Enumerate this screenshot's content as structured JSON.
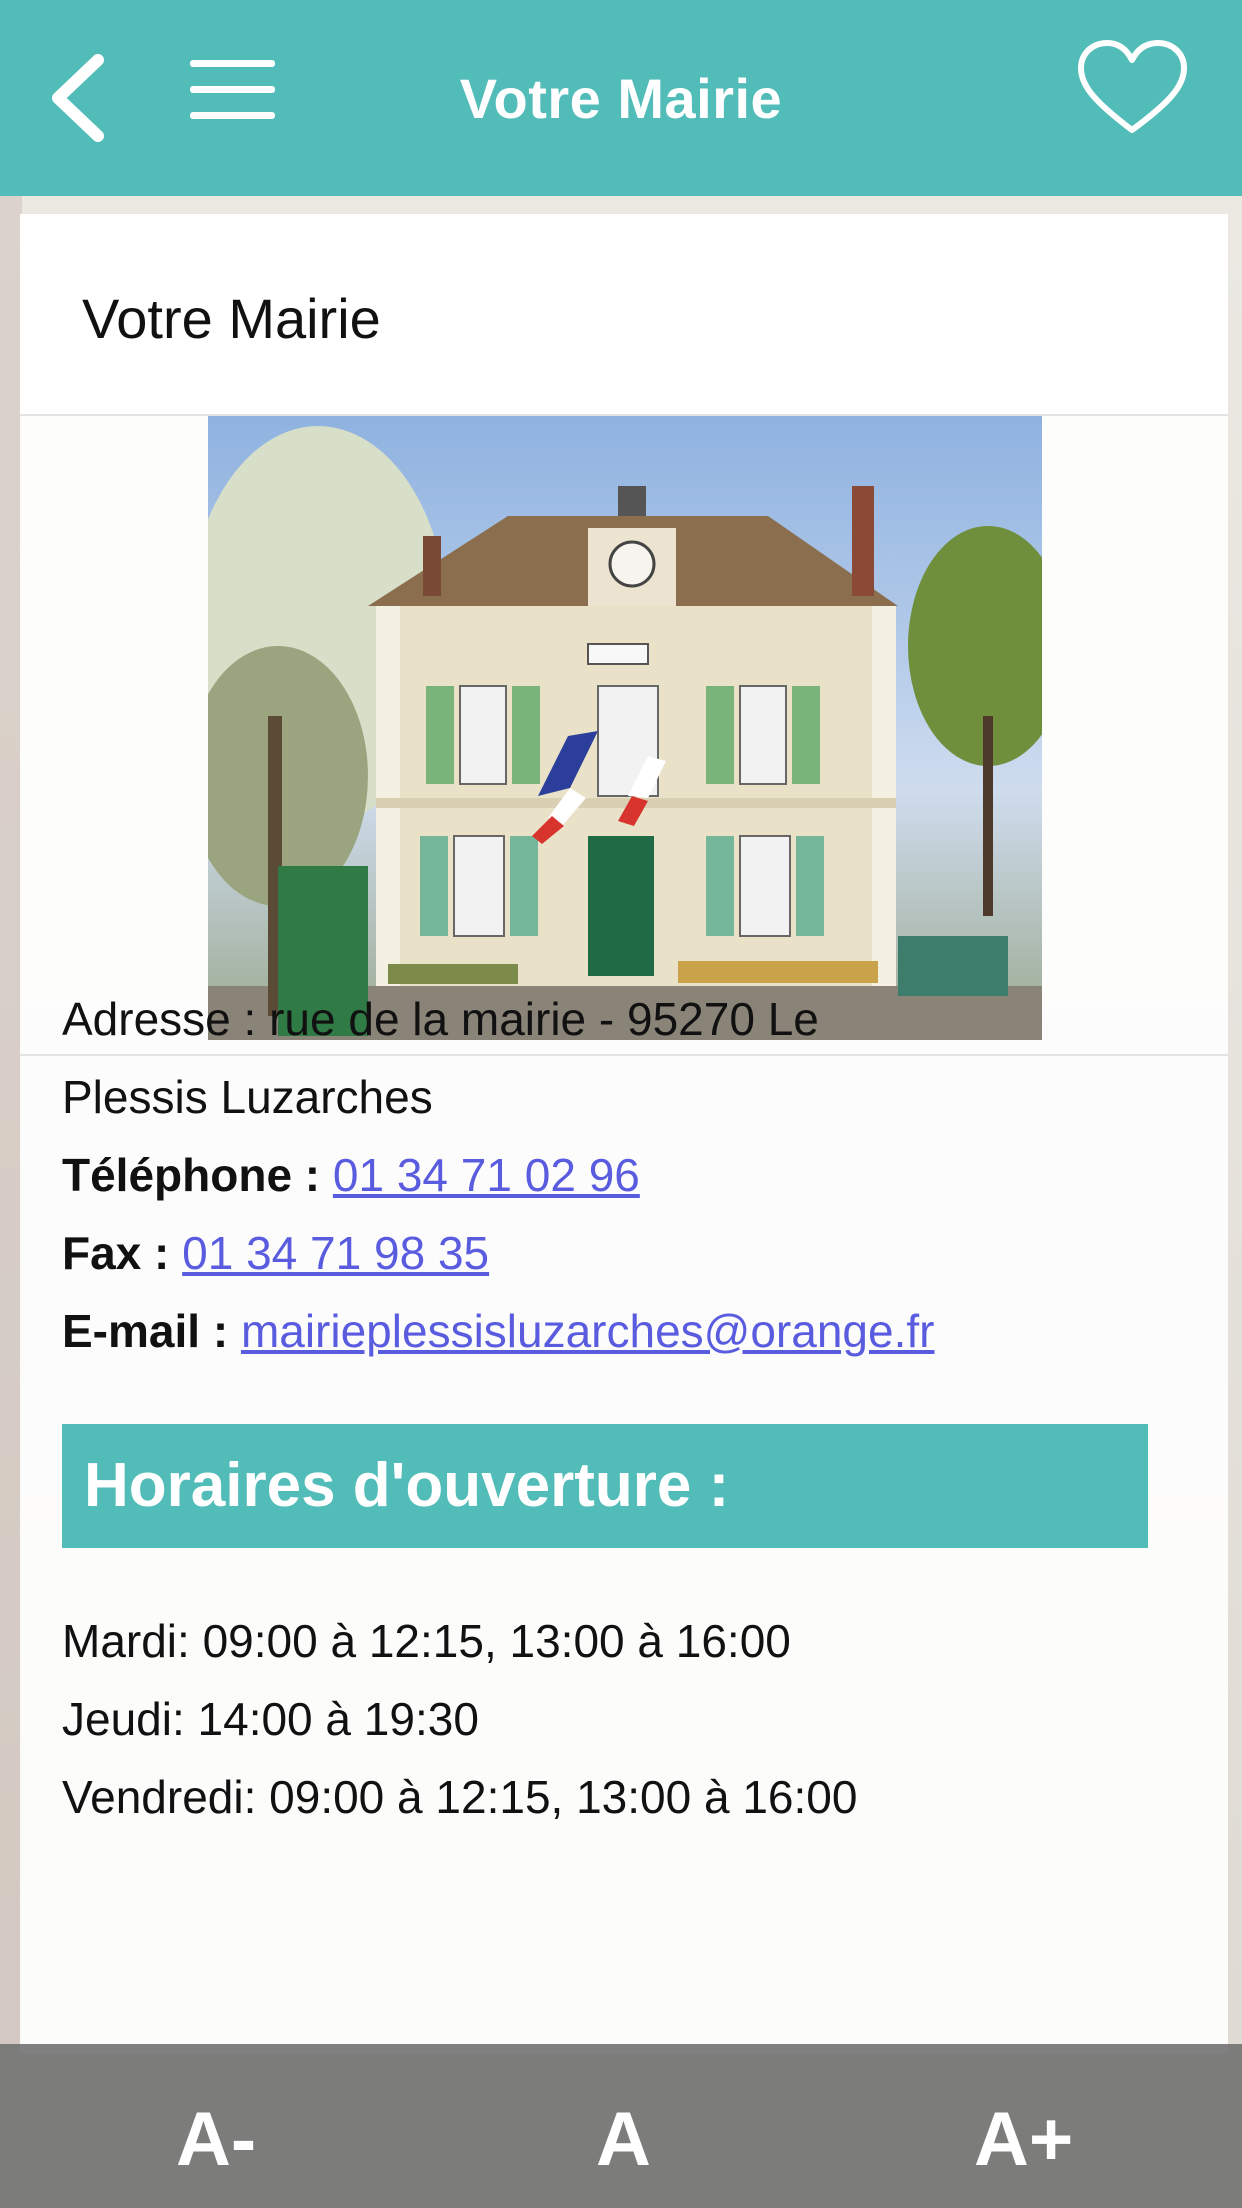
{
  "header": {
    "title": "Votre Mairie",
    "back_icon": "chevron-left-icon",
    "menu_icon": "hamburger-menu-icon",
    "favorite_icon": "heart-outline-icon"
  },
  "card": {
    "title": "Votre Mairie",
    "photo_alt": "Mairie"
  },
  "contact": {
    "address_text": "Adresse :  rue de la mairie - 95270 Le",
    "address_text2": "Plessis Luzarches",
    "phone_label": "Téléphone :",
    "phone_value": "01 34 71 02 96",
    "fax_label": "Fax :",
    "fax_value": "01 34 71 98 35",
    "email_label": "E-mail :",
    "email_value": "mairieplessisluzarches@orange.fr"
  },
  "hours": {
    "title": "Horaires d'ouverture :",
    "lines": [
      "Mardi: 09:00 à 12:15, 13:00 à 16:00",
      "Jeudi: 14:00 à 19:30",
      "Vendredi: 09:00 à 12:15, 13:00 à 16:00"
    ]
  },
  "font_controls": {
    "decrease": "A-",
    "reset": "A",
    "increase": "A+"
  },
  "colors": {
    "accent": "#52bcb8",
    "link": "#5a5ce0",
    "bottom_bar": "#6e6e6e"
  }
}
